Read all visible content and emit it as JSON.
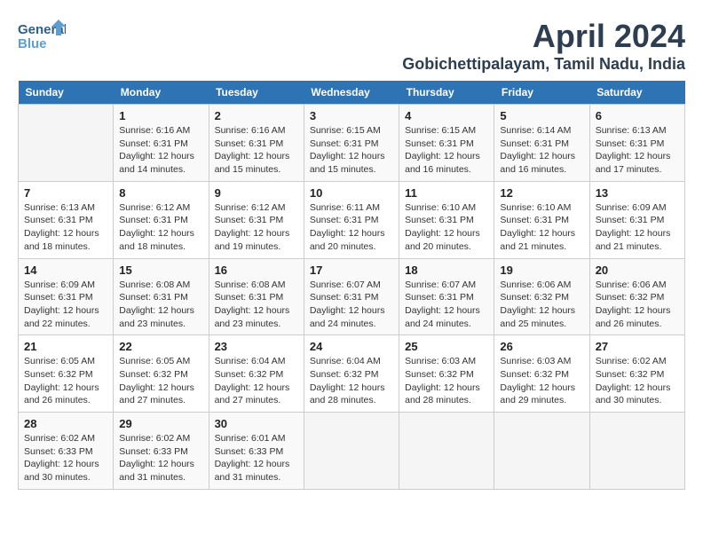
{
  "logo": {
    "line1": "General",
    "line2": "Blue"
  },
  "title": "April 2024",
  "subtitle": "Gobichettipalayam, Tamil Nadu, India",
  "days_of_week": [
    "Sunday",
    "Monday",
    "Tuesday",
    "Wednesday",
    "Thursday",
    "Friday",
    "Saturday"
  ],
  "weeks": [
    [
      {
        "day": "",
        "detail": ""
      },
      {
        "day": "1",
        "detail": "Sunrise: 6:16 AM\nSunset: 6:31 PM\nDaylight: 12 hours\nand 14 minutes."
      },
      {
        "day": "2",
        "detail": "Sunrise: 6:16 AM\nSunset: 6:31 PM\nDaylight: 12 hours\nand 15 minutes."
      },
      {
        "day": "3",
        "detail": "Sunrise: 6:15 AM\nSunset: 6:31 PM\nDaylight: 12 hours\nand 15 minutes."
      },
      {
        "day": "4",
        "detail": "Sunrise: 6:15 AM\nSunset: 6:31 PM\nDaylight: 12 hours\nand 16 minutes."
      },
      {
        "day": "5",
        "detail": "Sunrise: 6:14 AM\nSunset: 6:31 PM\nDaylight: 12 hours\nand 16 minutes."
      },
      {
        "day": "6",
        "detail": "Sunrise: 6:13 AM\nSunset: 6:31 PM\nDaylight: 12 hours\nand 17 minutes."
      }
    ],
    [
      {
        "day": "7",
        "detail": "Sunrise: 6:13 AM\nSunset: 6:31 PM\nDaylight: 12 hours\nand 18 minutes."
      },
      {
        "day": "8",
        "detail": "Sunrise: 6:12 AM\nSunset: 6:31 PM\nDaylight: 12 hours\nand 18 minutes."
      },
      {
        "day": "9",
        "detail": "Sunrise: 6:12 AM\nSunset: 6:31 PM\nDaylight: 12 hours\nand 19 minutes."
      },
      {
        "day": "10",
        "detail": "Sunrise: 6:11 AM\nSunset: 6:31 PM\nDaylight: 12 hours\nand 20 minutes."
      },
      {
        "day": "11",
        "detail": "Sunrise: 6:10 AM\nSunset: 6:31 PM\nDaylight: 12 hours\nand 20 minutes."
      },
      {
        "day": "12",
        "detail": "Sunrise: 6:10 AM\nSunset: 6:31 PM\nDaylight: 12 hours\nand 21 minutes."
      },
      {
        "day": "13",
        "detail": "Sunrise: 6:09 AM\nSunset: 6:31 PM\nDaylight: 12 hours\nand 21 minutes."
      }
    ],
    [
      {
        "day": "14",
        "detail": "Sunrise: 6:09 AM\nSunset: 6:31 PM\nDaylight: 12 hours\nand 22 minutes."
      },
      {
        "day": "15",
        "detail": "Sunrise: 6:08 AM\nSunset: 6:31 PM\nDaylight: 12 hours\nand 23 minutes."
      },
      {
        "day": "16",
        "detail": "Sunrise: 6:08 AM\nSunset: 6:31 PM\nDaylight: 12 hours\nand 23 minutes."
      },
      {
        "day": "17",
        "detail": "Sunrise: 6:07 AM\nSunset: 6:31 PM\nDaylight: 12 hours\nand 24 minutes."
      },
      {
        "day": "18",
        "detail": "Sunrise: 6:07 AM\nSunset: 6:31 PM\nDaylight: 12 hours\nand 24 minutes."
      },
      {
        "day": "19",
        "detail": "Sunrise: 6:06 AM\nSunset: 6:32 PM\nDaylight: 12 hours\nand 25 minutes."
      },
      {
        "day": "20",
        "detail": "Sunrise: 6:06 AM\nSunset: 6:32 PM\nDaylight: 12 hours\nand 26 minutes."
      }
    ],
    [
      {
        "day": "21",
        "detail": "Sunrise: 6:05 AM\nSunset: 6:32 PM\nDaylight: 12 hours\nand 26 minutes."
      },
      {
        "day": "22",
        "detail": "Sunrise: 6:05 AM\nSunset: 6:32 PM\nDaylight: 12 hours\nand 27 minutes."
      },
      {
        "day": "23",
        "detail": "Sunrise: 6:04 AM\nSunset: 6:32 PM\nDaylight: 12 hours\nand 27 minutes."
      },
      {
        "day": "24",
        "detail": "Sunrise: 6:04 AM\nSunset: 6:32 PM\nDaylight: 12 hours\nand 28 minutes."
      },
      {
        "day": "25",
        "detail": "Sunrise: 6:03 AM\nSunset: 6:32 PM\nDaylight: 12 hours\nand 28 minutes."
      },
      {
        "day": "26",
        "detail": "Sunrise: 6:03 AM\nSunset: 6:32 PM\nDaylight: 12 hours\nand 29 minutes."
      },
      {
        "day": "27",
        "detail": "Sunrise: 6:02 AM\nSunset: 6:32 PM\nDaylight: 12 hours\nand 30 minutes."
      }
    ],
    [
      {
        "day": "28",
        "detail": "Sunrise: 6:02 AM\nSunset: 6:33 PM\nDaylight: 12 hours\nand 30 minutes."
      },
      {
        "day": "29",
        "detail": "Sunrise: 6:02 AM\nSunset: 6:33 PM\nDaylight: 12 hours\nand 31 minutes."
      },
      {
        "day": "30",
        "detail": "Sunrise: 6:01 AM\nSunset: 6:33 PM\nDaylight: 12 hours\nand 31 minutes."
      },
      {
        "day": "",
        "detail": ""
      },
      {
        "day": "",
        "detail": ""
      },
      {
        "day": "",
        "detail": ""
      },
      {
        "day": "",
        "detail": ""
      }
    ]
  ]
}
